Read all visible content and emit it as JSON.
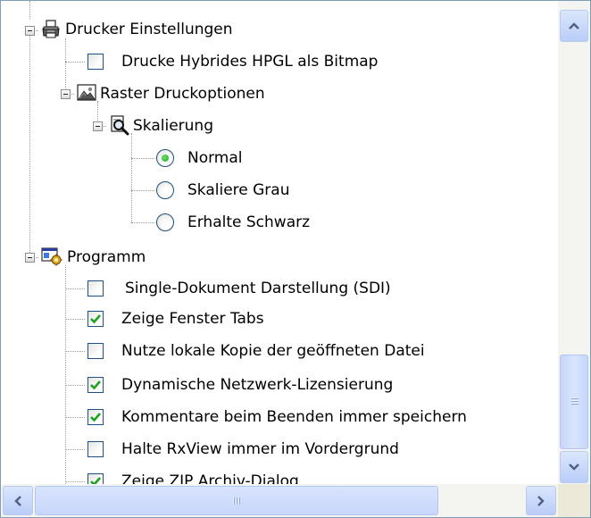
{
  "tree": {
    "printer_group": {
      "label": "Drucker Einstellungen",
      "icon": "printer-icon"
    },
    "hpgl_bitmap": {
      "label": "Drucke Hybrides HPGL als Bitmap",
      "checked": false
    },
    "raster_group": {
      "label": "Raster Druckoptionen",
      "icon": "raster-image-icon"
    },
    "scaling_group": {
      "label": "Skalierung",
      "icon": "magnifier-document-icon"
    },
    "scaling_options": [
      {
        "label": "Normal",
        "selected": true
      },
      {
        "label": "Skaliere Grau",
        "selected": false
      },
      {
        "label": "Erhalte Schwarz",
        "selected": false
      }
    ],
    "program_group": {
      "label": "Programm",
      "icon": "program-settings-icon"
    },
    "program_options": [
      {
        "label": "Single-Dokument Darstellung (SDI)",
        "checked": false
      },
      {
        "label": "Zeige Fenster Tabs",
        "checked": true
      },
      {
        "label": "Nutze lokale Kopie der geöffneten Datei",
        "checked": false
      },
      {
        "label": "Dynamische Netzwerk-Lizensierung",
        "checked": true
      },
      {
        "label": "Kommentare beim Beenden immer speichern",
        "checked": true
      },
      {
        "label": "Halte RxView immer im Vordergrund",
        "checked": false
      },
      {
        "label": "Zeige ZIP Archiv-Dialog",
        "checked": true
      }
    ]
  },
  "scrollbars": {
    "vertical": {
      "up_icon": "chevron-up-icon",
      "down_icon": "chevron-down-icon",
      "position_fraction": 0.85
    },
    "horizontal": {
      "left_icon": "chevron-left-icon",
      "right_icon": "chevron-right-icon",
      "position_fraction": 0.0
    }
  },
  "colors": {
    "check": "#21a121",
    "border": "#1c5180",
    "scrollbar": "#c7d6fb"
  }
}
